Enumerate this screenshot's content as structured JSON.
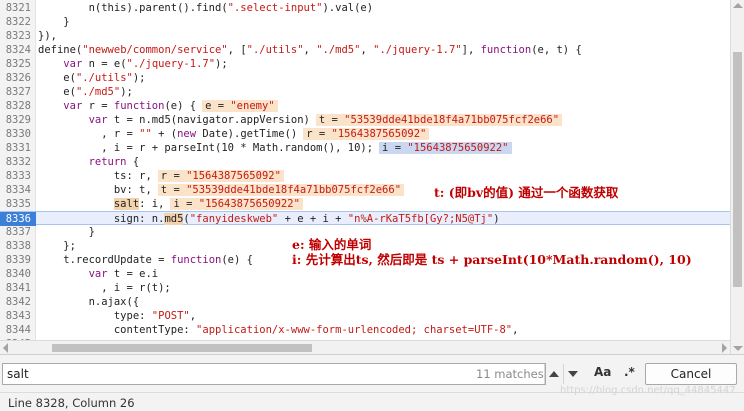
{
  "editor": {
    "lines": [
      {
        "num": "8321",
        "tokens": [
          {
            "t": "        n(this).parent().find(",
            "c": "plain"
          },
          {
            "t": "\".select-input\"",
            "c": "str"
          },
          {
            "t": ").val(e)",
            "c": "plain"
          }
        ]
      },
      {
        "num": "8322",
        "tokens": [
          {
            "t": "    }",
            "c": "plain"
          }
        ]
      },
      {
        "num": "8323",
        "tokens": [
          {
            "t": "}),",
            "c": "plain"
          }
        ]
      },
      {
        "num": "8324",
        "tokens": [
          {
            "t": "define(",
            "c": "plain"
          },
          {
            "t": "\"newweb/common/service\"",
            "c": "str"
          },
          {
            "t": ", [",
            "c": "plain"
          },
          {
            "t": "\"./utils\"",
            "c": "str"
          },
          {
            "t": ", ",
            "c": "plain"
          },
          {
            "t": "\"./md5\"",
            "c": "str"
          },
          {
            "t": ", ",
            "c": "plain"
          },
          {
            "t": "\"./jquery-1.7\"",
            "c": "str"
          },
          {
            "t": "], ",
            "c": "plain"
          },
          {
            "t": "function",
            "c": "kw"
          },
          {
            "t": "(e, t) {",
            "c": "plain"
          }
        ]
      },
      {
        "num": "8325",
        "tokens": [
          {
            "t": "    ",
            "c": "plain"
          },
          {
            "t": "var",
            "c": "kw"
          },
          {
            "t": " n = e(",
            "c": "plain"
          },
          {
            "t": "\"./jquery-1.7\"",
            "c": "str"
          },
          {
            "t": ");",
            "c": "plain"
          }
        ]
      },
      {
        "num": "8326",
        "tokens": [
          {
            "t": "    e(",
            "c": "plain"
          },
          {
            "t": "\"./utils\"",
            "c": "str"
          },
          {
            "t": ");",
            "c": "plain"
          }
        ]
      },
      {
        "num": "8327",
        "tokens": [
          {
            "t": "    e(",
            "c": "plain"
          },
          {
            "t": "\"./md5\"",
            "c": "str"
          },
          {
            "t": ");",
            "c": "plain"
          }
        ]
      },
      {
        "num": "8328",
        "tokens": [
          {
            "t": "    ",
            "c": "plain"
          },
          {
            "t": "var",
            "c": "kw"
          },
          {
            "t": " r = ",
            "c": "plain"
          },
          {
            "t": "function",
            "c": "kw"
          },
          {
            "t": "(e) {",
            "c": "plain"
          },
          {
            "pop": true,
            "name": "e = ",
            "val": "\"enemy\""
          }
        ]
      },
      {
        "num": "8329",
        "tokens": [
          {
            "t": "        ",
            "c": "plain"
          },
          {
            "t": "var",
            "c": "kw"
          },
          {
            "t": " t = n.md5(navigator.appVersion)",
            "c": "plain"
          },
          {
            "pop": true,
            "name": "t = ",
            "val": "\"53539dde41bde18f4a71bb075fcf2e66\""
          }
        ]
      },
      {
        "num": "8330",
        "tokens": [
          {
            "t": "          , r = ",
            "c": "plain"
          },
          {
            "t": "\"\"",
            "c": "str"
          },
          {
            "t": " + (",
            "c": "plain"
          },
          {
            "t": "new",
            "c": "kw"
          },
          {
            "t": " Date).getTime()",
            "c": "plain"
          },
          {
            "pop": true,
            "name": "r = ",
            "val": "\"1564387565092\""
          }
        ]
      },
      {
        "num": "8331",
        "tokens": [
          {
            "t": "          , i = r + parseInt(10 * Math.random(), 10);",
            "c": "plain"
          },
          {
            "pop": true,
            "blue": true,
            "name": "i = ",
            "val": "\"15643875650922\""
          }
        ]
      },
      {
        "num": "8332",
        "tokens": [
          {
            "t": "        ",
            "c": "plain"
          },
          {
            "t": "return",
            "c": "kw"
          },
          {
            "t": " {",
            "c": "plain"
          }
        ]
      },
      {
        "num": "8333",
        "tokens": [
          {
            "t": "            ts: r,",
            "c": "plain"
          },
          {
            "pop": true,
            "name": "r = ",
            "val": "\"1564387565092\""
          }
        ]
      },
      {
        "num": "8334",
        "tokens": [
          {
            "t": "            bv: t,",
            "c": "plain"
          },
          {
            "pop": true,
            "name": "t = ",
            "val": "\"53539dde41bde18f4a71bb075fcf2e66\""
          }
        ]
      },
      {
        "num": "8335",
        "tokens": [
          {
            "t": "            ",
            "c": "plain"
          },
          {
            "t": "salt",
            "c": "hl"
          },
          {
            "t": ": i,",
            "c": "plain"
          },
          {
            "pop": true,
            "name": "i = ",
            "val": "\"15643875650922\""
          }
        ]
      },
      {
        "num": "8336",
        "active": true,
        "tokens": [
          {
            "t": "            sign: n.",
            "c": "plain"
          },
          {
            "t": "md5",
            "c": "hl"
          },
          {
            "t": "(",
            "c": "plain"
          },
          {
            "t": "\"fanyideskweb\"",
            "c": "str"
          },
          {
            "t": " + e + i + ",
            "c": "plain"
          },
          {
            "t": "\"n%A-rKaT5fb[Gy?;N5@Tj\"",
            "c": "str"
          },
          {
            "t": ")",
            "c": "plain"
          }
        ]
      },
      {
        "num": "8337",
        "tokens": [
          {
            "t": "        }",
            "c": "plain"
          }
        ]
      },
      {
        "num": "8338",
        "tokens": [
          {
            "t": "    };",
            "c": "plain"
          }
        ]
      },
      {
        "num": "8339",
        "tokens": [
          {
            "t": "    t.recordUpdate = ",
            "c": "plain"
          },
          {
            "t": "function",
            "c": "kw"
          },
          {
            "t": "(e) {",
            "c": "plain"
          }
        ]
      },
      {
        "num": "8340",
        "tokens": [
          {
            "t": "        ",
            "c": "plain"
          },
          {
            "t": "var",
            "c": "kw"
          },
          {
            "t": " t = e.i",
            "c": "plain"
          }
        ]
      },
      {
        "num": "8341",
        "tokens": [
          {
            "t": "          , i = r(t);",
            "c": "plain"
          }
        ]
      },
      {
        "num": "8342",
        "tokens": [
          {
            "t": "        n.ajax({",
            "c": "plain"
          }
        ]
      },
      {
        "num": "8343",
        "tokens": [
          {
            "t": "            type: ",
            "c": "plain"
          },
          {
            "t": "\"POST\"",
            "c": "str"
          },
          {
            "t": ",",
            "c": "plain"
          }
        ]
      },
      {
        "num": "8344",
        "tokens": [
          {
            "t": "            contentType: ",
            "c": "plain"
          },
          {
            "t": "\"application/x-www-form-urlencoded; charset=UTF-8\"",
            "c": "str"
          },
          {
            "t": ",",
            "c": "plain"
          }
        ]
      },
      {
        "num": "8345",
        "tokens": [
          {
            "t": "            ",
            "c": "plain"
          }
        ]
      }
    ]
  },
  "annotations": {
    "bv_note": "t: (即bv的值) 通过一个函数获取",
    "e_note": "e: 输入的单词",
    "i_note": "i: 先计算出ts, 然后即是 ts + parseInt(10*Math.random(), 10)"
  },
  "search": {
    "value": "salt",
    "match_count": "11 matches",
    "case_label": "Aa",
    "regex_label": ".*",
    "cancel_label": "Cancel"
  },
  "status": {
    "text": "Line 8328, Column 26"
  },
  "watermark": "https://blog.csdn.net/qq_44845447"
}
